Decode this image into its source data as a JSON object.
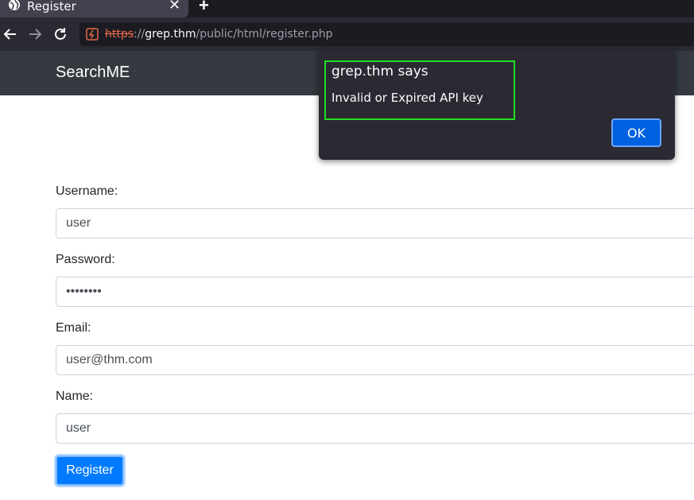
{
  "browser": {
    "tab_title": "Register",
    "tab_icon": "globe-icon",
    "url_scheme": "https",
    "url_sep": "://",
    "url_host": "grep.thm",
    "url_path": "/public/html/register.php"
  },
  "header": {
    "brand": "SearchME"
  },
  "form": {
    "username_label": "Username:",
    "username_value": "user",
    "password_label": "Password:",
    "password_value": "••••••••",
    "email_label": "Email:",
    "email_value": "user@thm.com",
    "name_label": "Name:",
    "name_value": "user",
    "submit_label": "Register"
  },
  "dialog": {
    "title": "grep.thm says",
    "message": "Invalid or Expired API key",
    "ok_label": "OK"
  },
  "colors": {
    "header_bg": "#343a40",
    "primary": "#007bff",
    "dialog_bg": "#2b2a33",
    "highlight": "#22dd22"
  }
}
